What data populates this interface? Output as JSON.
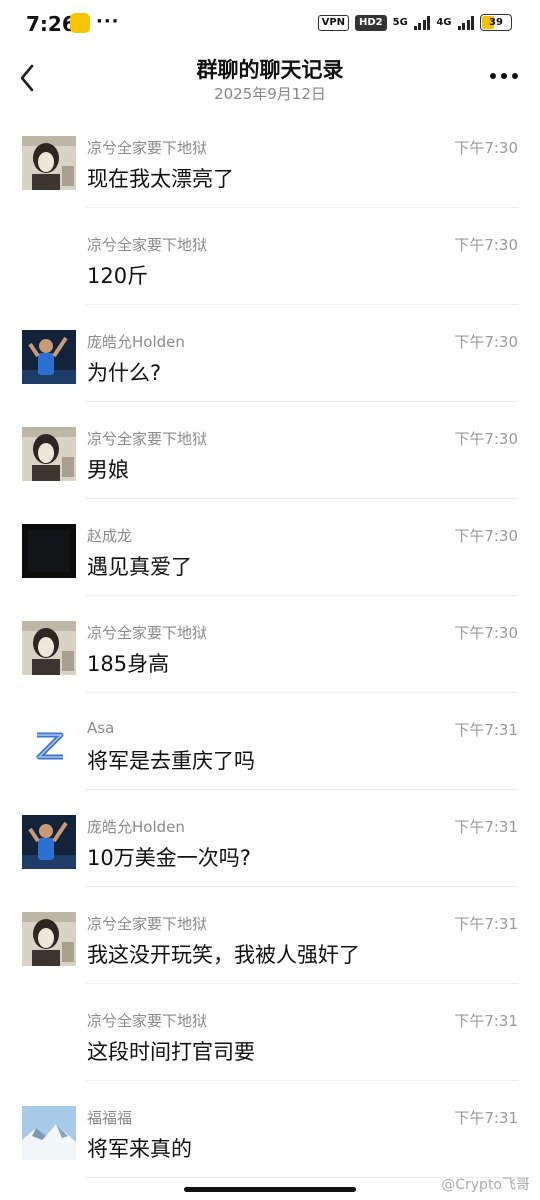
{
  "status_bar": {
    "time": "7:26",
    "vpn": "VPN",
    "hd": "HD2",
    "net1": "5G",
    "net2": "4G",
    "battery": "39"
  },
  "header": {
    "title": "群聊的聊天记录",
    "subtitle": "2025年9月12日"
  },
  "messages": [
    {
      "sender": "凉兮全家要下地狱",
      "time": "下午7:30",
      "text": "现在我太漂亮了"
    },
    {
      "sender": "凉兮全家要下地狱",
      "time": "下午7:30",
      "text": "120斤"
    },
    {
      "sender": "庞皓允Holden",
      "time": "下午7:30",
      "text": "为什么?"
    },
    {
      "sender": "凉兮全家要下地狱",
      "time": "下午7:30",
      "text": "男娘"
    },
    {
      "sender": "赵成龙",
      "time": "下午7:30",
      "text": "遇见真爱了"
    },
    {
      "sender": "凉兮全家要下地狱",
      "time": "下午7:30",
      "text": "185身高"
    },
    {
      "sender": "Asa",
      "time": "下午7:31",
      "text": "将军是去重庆了吗"
    },
    {
      "sender": "庞皓允Holden",
      "time": "下午7:31",
      "text": "10万美金一次吗?"
    },
    {
      "sender": "凉兮全家要下地狱",
      "time": "下午7:31",
      "text": "我这没开玩笑，我被人强奸了"
    },
    {
      "sender": "凉兮全家要下地狱",
      "time": "下午7:31",
      "text": "这段时间打官司要"
    },
    {
      "sender": "福福福",
      "time": "下午7:31",
      "text": "将军来真的"
    }
  ],
  "watermark": "@Crypto飞哥"
}
